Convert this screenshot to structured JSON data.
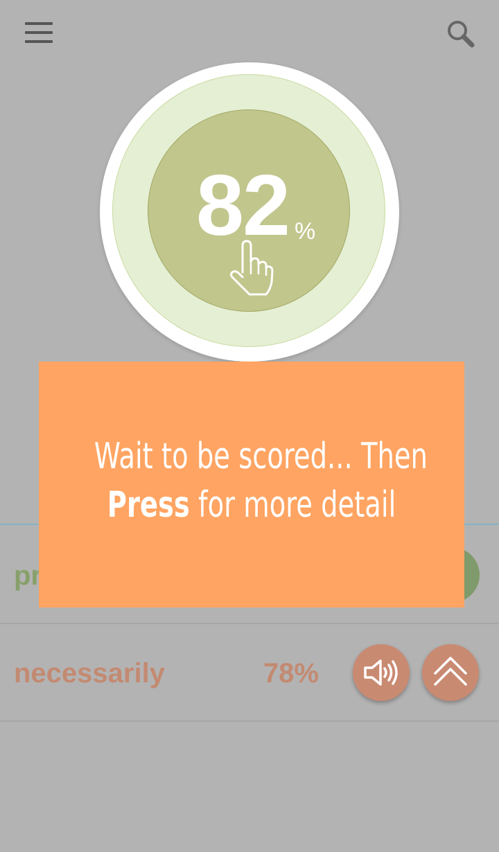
{
  "header": {
    "menu_icon": "hamburger-menu-icon",
    "search_icon": "search-icon"
  },
  "score_ring": {
    "value": "82",
    "unit": "%",
    "hint_icon": "tap-hand-icon",
    "colors": {
      "outer": "#ffffff",
      "middle": "#e4efd4",
      "inner": "#c1c68d"
    }
  },
  "words": [
    {
      "word": "pr",
      "score": "",
      "color": "#87a06a"
    },
    {
      "word": "necessarily",
      "score": "78%",
      "color": "#c38a72",
      "actions": {
        "play_icon": "speaker-icon",
        "expand_icon": "chevron-double-up-icon"
      }
    }
  ],
  "tip_overlay": {
    "line1": "Wait to be scored... Then",
    "line2_bold": "Press",
    "line2_rest": " for more detail",
    "background": "#ffa462"
  }
}
